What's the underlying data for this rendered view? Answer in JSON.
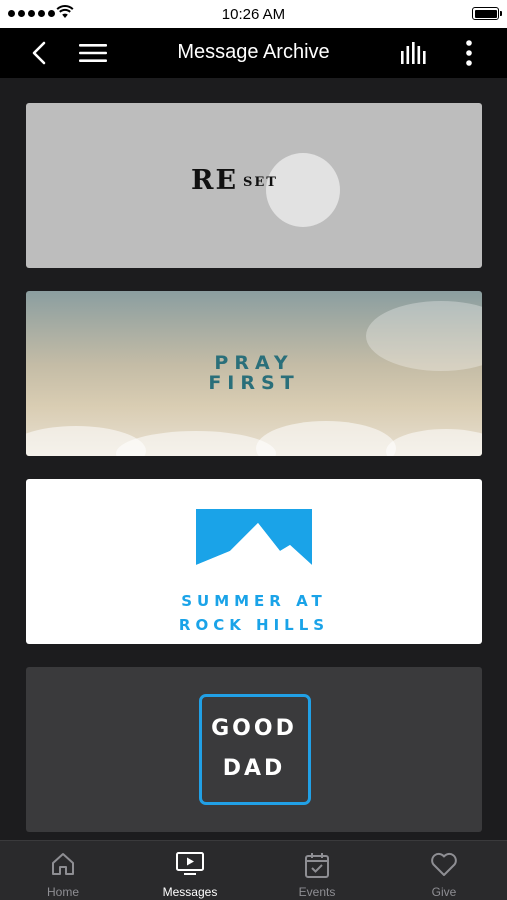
{
  "status_bar": {
    "time": "10:26 AM",
    "signal_icon": "signal-dots-icon",
    "wifi_icon": "wifi-icon",
    "battery_icon": "battery-icon",
    "battery_level": 1.0
  },
  "nav": {
    "title": "Message Archive",
    "back_icon": "chevron-left-icon",
    "menu_icon": "hamburger-menu-icon",
    "audio_icon": "audio-bars-icon",
    "more_icon": "more-vertical-icon"
  },
  "series": [
    {
      "title_main": "RE",
      "title_suffix": "SET",
      "background": "#bdbdbd"
    },
    {
      "line1": "PRAY",
      "line2": "FIRST",
      "color": "#2a6f7a"
    },
    {
      "line1": "SUMMER AT",
      "line2": "ROCK HILLS",
      "color": "#1aa3e8",
      "logo": "mountain-logo"
    },
    {
      "line1": "GOOD",
      "line2": "DAD",
      "border_color": "#21a0e6",
      "background": "#3a3a3c"
    }
  ],
  "tabs": [
    {
      "label": "Home",
      "icon": "home-icon",
      "active": false
    },
    {
      "label": "Messages",
      "icon": "tv-play-icon",
      "active": true
    },
    {
      "label": "Events",
      "icon": "calendar-check-icon",
      "active": false
    },
    {
      "label": "Give",
      "icon": "heart-icon",
      "active": false
    }
  ],
  "colors": {
    "nav_background": "#000000",
    "content_background": "#1c1c1e",
    "tab_bar_background": "#2a2a2c",
    "tab_active": "#ffffff",
    "tab_inactive": "#8e8e93"
  }
}
